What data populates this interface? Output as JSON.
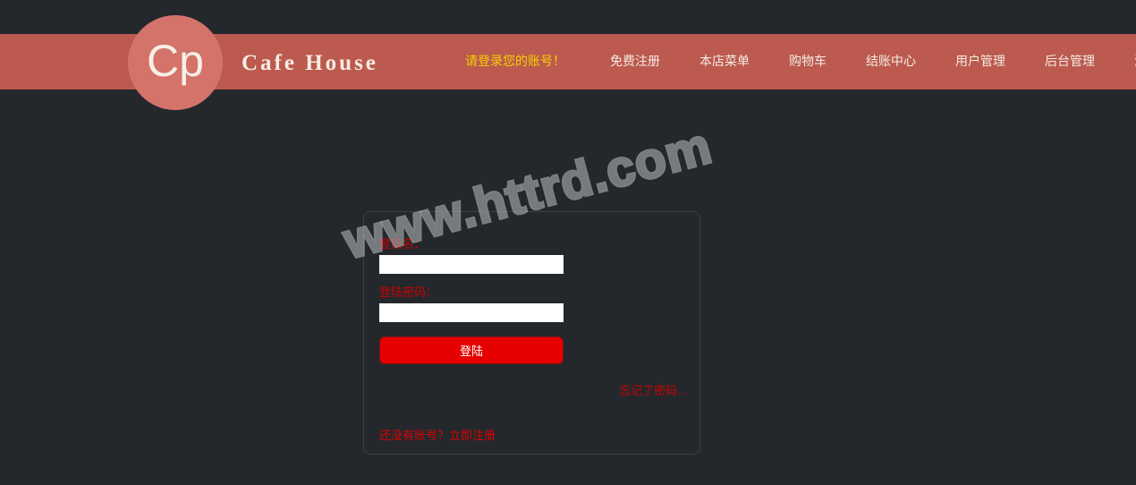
{
  "header": {
    "logo_text": "Cp",
    "brand_title": "Cafe  House",
    "bar_color": "#bc5a4f",
    "logo_color": "#d4736a",
    "nav": [
      {
        "label": "请登录您的账号！",
        "accent": true,
        "color": "#f5d000"
      },
      {
        "label": "免费注册",
        "accent": false,
        "color": "#f3ece4"
      },
      {
        "label": "本店菜单",
        "accent": false,
        "color": "#f3ece4"
      },
      {
        "label": "购物车",
        "accent": false,
        "color": "#f3ece4"
      },
      {
        "label": "结账中心",
        "accent": false,
        "color": "#f3ece4"
      },
      {
        "label": "用户管理",
        "accent": false,
        "color": "#f3ece4"
      },
      {
        "label": "后台管理",
        "accent": false,
        "color": "#f3ece4"
      },
      {
        "label": "注销",
        "accent": false,
        "color": "#f3ece4"
      }
    ]
  },
  "login": {
    "username_label": "登陆名：",
    "username_value": "",
    "username_placeholder": "",
    "password_label": "登陆密码：",
    "password_value": "",
    "password_placeholder": "",
    "submit_label": "登陆",
    "forgot_link": "忘记了密码...",
    "register_link": "还没有账号？立即注册",
    "link_color": "#cc0000",
    "button_color": "#e60000"
  },
  "watermark": {
    "text": "www.httrd.com"
  },
  "page": {
    "background_color": "#24282c"
  }
}
